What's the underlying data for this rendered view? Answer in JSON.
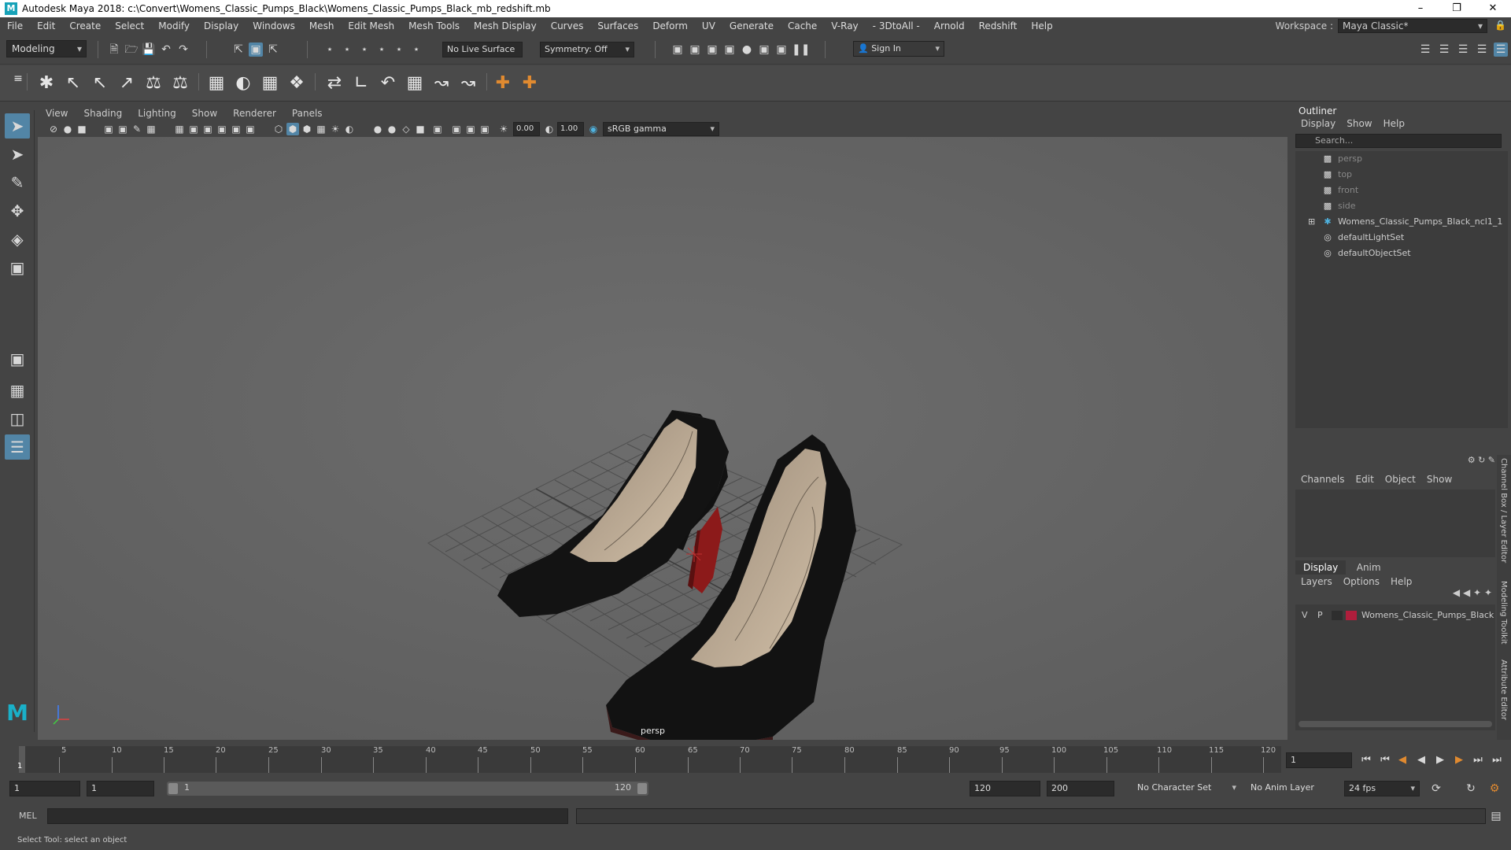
{
  "window": {
    "title": "Autodesk Maya 2018: c:\\Convert\\Womens_Classic_Pumps_Black\\Womens_Classic_Pumps_Black_mb_redshift.mb",
    "app_icon": "M",
    "minimize": "–",
    "maximize": "❐",
    "close": "✕"
  },
  "menubar": {
    "items": [
      "File",
      "Edit",
      "Create",
      "Select",
      "Modify",
      "Display",
      "Windows",
      "Mesh",
      "Edit Mesh",
      "Mesh Tools",
      "Mesh Display",
      "Curves",
      "Surfaces",
      "Deform",
      "UV",
      "Generate",
      "Cache",
      "V-Ray",
      "- 3DtoAll -",
      "Arnold",
      "Redshift",
      "Help"
    ],
    "workspace_label": "Workspace :",
    "workspace_value": "Maya Classic*"
  },
  "statusline": {
    "mode": "Modeling",
    "live_surface": "No Live Surface",
    "symmetry": "Symmetry: Off",
    "sign_in": "Sign In"
  },
  "viewport": {
    "menu": [
      "View",
      "Shading",
      "Lighting",
      "Show",
      "Renderer",
      "Panels"
    ],
    "exposure": "0.00",
    "gamma": "1.00",
    "color_space": "sRGB gamma",
    "camera_label": "persp"
  },
  "outliner": {
    "title": "Outliner",
    "menu": [
      "Display",
      "Show",
      "Help"
    ],
    "search_placeholder": "Search...",
    "items": [
      {
        "label": "persp",
        "icon": "camera-icon",
        "dim": true
      },
      {
        "label": "top",
        "icon": "camera-icon",
        "dim": true
      },
      {
        "label": "front",
        "icon": "camera-icon",
        "dim": true
      },
      {
        "label": "side",
        "icon": "camera-icon",
        "dim": true
      },
      {
        "label": "Womens_Classic_Pumps_Black_ncl1_1",
        "icon": "group-icon",
        "dim": false,
        "expandable": true
      },
      {
        "label": "defaultLightSet",
        "icon": "set-icon",
        "dim": false
      },
      {
        "label": "defaultObjectSet",
        "icon": "set-icon",
        "dim": false
      }
    ]
  },
  "channelbox": {
    "menu": [
      "Channels",
      "Edit",
      "Object",
      "Show"
    ]
  },
  "layers": {
    "tabs": [
      "Display",
      "Anim"
    ],
    "menu": [
      "Layers",
      "Options",
      "Help"
    ],
    "layer": {
      "v": "V",
      "p": "P",
      "name": "Womens_Classic_Pumps_Black",
      "color": "#b01e3c"
    }
  },
  "side_tabs": [
    "Channel Box / Layer Editor",
    "Modeling Toolkit",
    "Attribute Editor"
  ],
  "timeline": {
    "ticks": [
      "5",
      "10",
      "15",
      "20",
      "25",
      "30",
      "35",
      "40",
      "45",
      "50",
      "55",
      "60",
      "65",
      "70",
      "75",
      "80",
      "85",
      "90",
      "95",
      "100",
      "105",
      "110",
      "115",
      "120"
    ],
    "current_marker": "1",
    "current_frame": "1"
  },
  "range": {
    "start": "1",
    "playback_start": "1",
    "slider_left": "1",
    "slider_right": "120",
    "playback_end": "120",
    "end": "200",
    "character_set": "No Character Set",
    "anim_layer": "No Anim Layer",
    "fps": "24 fps"
  },
  "cmdline": {
    "label": "MEL"
  },
  "helpline": {
    "text": "Select Tool: select an object"
  },
  "colors": {
    "viewport_bg": "#6a6a6a",
    "panel_bg": "#444444",
    "accent": "#5285a6",
    "heel_red": "#8c1a1a"
  }
}
